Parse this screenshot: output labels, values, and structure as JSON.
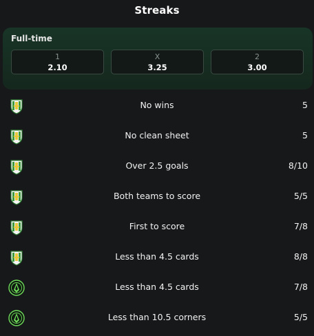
{
  "title": "Streaks",
  "odds": {
    "heading": "Full-time",
    "options": [
      {
        "label": "1",
        "value": "2.10"
      },
      {
        "label": "X",
        "value": "3.25"
      },
      {
        "label": "2",
        "value": "3.00"
      }
    ]
  },
  "streaks": [
    {
      "team_icon": "shield-crest-icon",
      "label": "No wins",
      "value": "5"
    },
    {
      "team_icon": "shield-crest-icon",
      "label": "No clean sheet",
      "value": "5"
    },
    {
      "team_icon": "shield-crest-icon",
      "label": "Over 2.5 goals",
      "value": "8/10"
    },
    {
      "team_icon": "shield-crest-icon",
      "label": "Both teams to score",
      "value": "5/5"
    },
    {
      "team_icon": "shield-crest-icon",
      "label": "First to score",
      "value": "7/8"
    },
    {
      "team_icon": "shield-crest-icon",
      "label": "Less than 4.5 cards",
      "value": "8/8"
    },
    {
      "team_icon": "round-crest-icon",
      "label": "Less than 4.5 cards",
      "value": "7/8"
    },
    {
      "team_icon": "round-crest-icon",
      "label": "Less than 10.5 corners",
      "value": "5/5"
    }
  ],
  "colors": {
    "background": "#17181a",
    "card_gradient_top": "#183527",
    "team_home_green": "#3c9a3a",
    "team_home_yellow": "#e6c73a",
    "team_away_green": "#6fdc5a"
  }
}
